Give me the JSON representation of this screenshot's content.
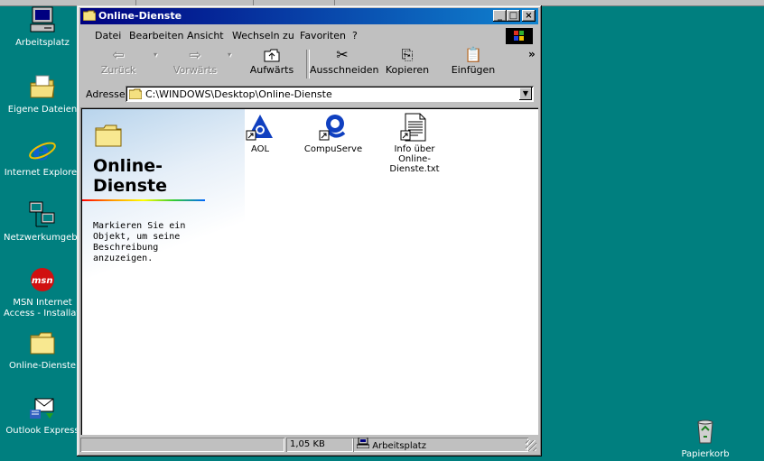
{
  "desktop": {
    "icons": [
      {
        "label": "Arbeitsplatz",
        "icon": "my-computer-icon"
      },
      {
        "label": "Eigene Dateien",
        "icon": "my-documents-icon"
      },
      {
        "label": "Internet Explorer",
        "icon": "internet-explorer-icon"
      },
      {
        "label": "Netzwerkumgebung",
        "icon": "network-neighborhood-icon"
      },
      {
        "label": "MSN Internet",
        "label2": "Access - Installation",
        "icon": "msn-icon"
      },
      {
        "label": "Online-Dienste",
        "icon": "folder-icon"
      },
      {
        "label": "Outlook Express",
        "icon": "outlook-express-icon"
      },
      {
        "label": "Papierkorb",
        "icon": "recycle-bin-icon"
      }
    ]
  },
  "window": {
    "title": "Online-Dienste",
    "menu": [
      "Datei",
      "Bearbeiten",
      "Ansicht",
      "Wechseln zu",
      "Favoriten",
      "?"
    ],
    "toolbar": {
      "back": "Zurück",
      "forward": "Vorwärts",
      "up": "Aufwärts",
      "cut": "Ausschneiden",
      "copy": "Kopieren",
      "paste": "Einfügen",
      "more": "»"
    },
    "address": {
      "label": "Adresse",
      "value": "C:\\WINDOWS\\Desktop\\Online-Dienste"
    },
    "webview": {
      "title": "Online-Dienste",
      "description": "Markieren Sie ein Objekt, um seine Beschreibung anzuzeigen."
    },
    "files": [
      {
        "label": "AOL",
        "icon": "aol-icon"
      },
      {
        "label": "CompuServe",
        "icon": "compuserve-icon"
      },
      {
        "label": "Info über",
        "label2": "Online-Dienste.txt",
        "icon": "text-file-icon"
      }
    ],
    "status": {
      "size": "1,05 KB",
      "zone": "Arbeitsplatz"
    }
  },
  "colors": {
    "desktop": "#007f7f",
    "titlebar": "#000080",
    "window": "#c0c0c0"
  }
}
